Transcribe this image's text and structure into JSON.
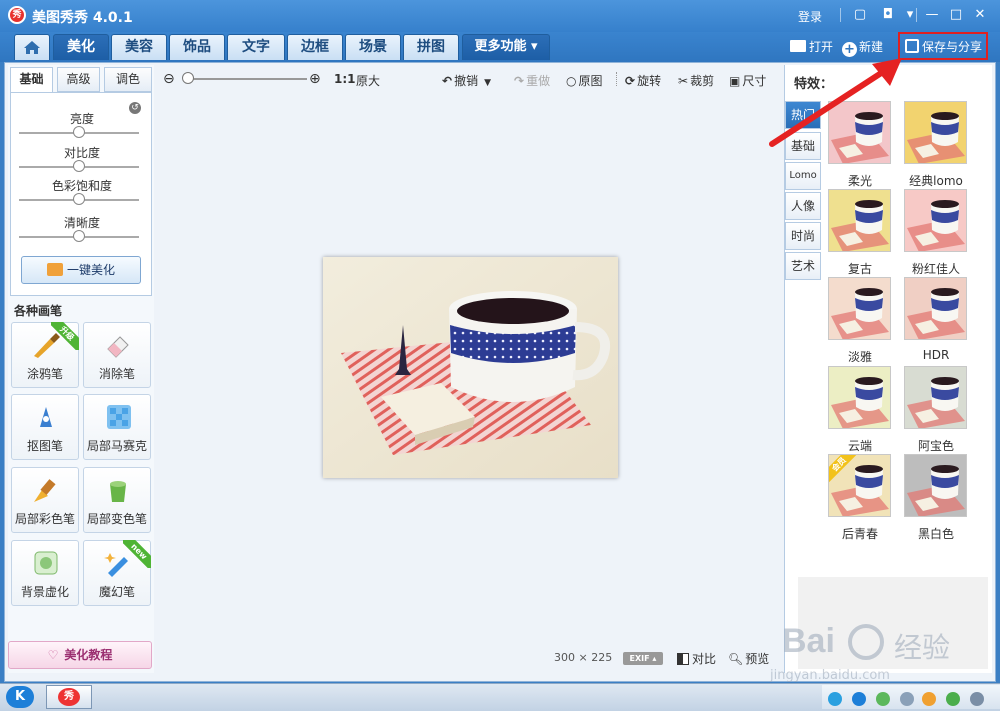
{
  "window": {
    "title": "美图秀秀 4.0.1",
    "logo_text": "秀",
    "login": "登录"
  },
  "main_tabs": [
    "美化",
    "美容",
    "饰品",
    "文字",
    "边框",
    "场景",
    "拼图"
  ],
  "more_tab": "更多功能 ▾",
  "actions": {
    "open": "打开",
    "new": "新建",
    "save_share": "保存与分享"
  },
  "sub_tabs": [
    "基础",
    "高级",
    "调色"
  ],
  "sliders": [
    {
      "label": "亮度",
      "level": 0.5
    },
    {
      "label": "对比度",
      "level": 0.5
    },
    {
      "label": "色彩饱和度",
      "level": 0.5
    },
    {
      "label": "清晰度",
      "level": 0.5
    }
  ],
  "one_key_button": "一键美化",
  "brush_section_title": "各种画笔",
  "brushes": [
    {
      "label": "涂鸦笔",
      "badge": "升级",
      "icon": "brush-icon"
    },
    {
      "label": "消除笔",
      "badge": "",
      "icon": "eraser-icon"
    },
    {
      "label": "抠图笔",
      "badge": "",
      "icon": "cutout-pen-icon"
    },
    {
      "label": "局部马赛克",
      "badge": "",
      "icon": "mosaic-icon"
    },
    {
      "label": "局部彩色笔",
      "badge": "",
      "icon": "color-brush-icon"
    },
    {
      "label": "局部变色笔",
      "badge": "",
      "icon": "paint-bucket-icon"
    },
    {
      "label": "背景虚化",
      "badge": "",
      "icon": "blur-icon"
    },
    {
      "label": "魔幻笔",
      "badge": "new",
      "icon": "magic-pen-icon"
    }
  ],
  "tutorial_button": "美化教程",
  "toolbar": {
    "zoom_ratio": "1:1",
    "original_size": "原大",
    "undo": "撤销",
    "redo": "重做",
    "original": "原图",
    "rotate": "旋转",
    "crop": "裁剪",
    "size": "尺寸"
  },
  "image_info": {
    "width": "300",
    "times": "×",
    "height": "225",
    "exif": "EXIF"
  },
  "bottom_tools": {
    "compare": "对比",
    "preview": "预览"
  },
  "effects": {
    "title": "特效：",
    "categories": [
      "热门",
      "基础",
      "Lomo",
      "人像",
      "时尚",
      "艺术"
    ],
    "items": [
      {
        "label": "柔光",
        "tint": "#f3c6c9"
      },
      {
        "label": "经典lomo",
        "tint": "#f2d36f"
      },
      {
        "label": "复古",
        "tint": "#efe08f"
      },
      {
        "label": "粉红佳人",
        "tint": "#f7c9c6"
      },
      {
        "label": "淡雅",
        "tint": "#f4dccd"
      },
      {
        "label": "HDR",
        "tint": "#f0cfc4"
      },
      {
        "label": "云端",
        "tint": "#eceec4"
      },
      {
        "label": "阿宝色",
        "tint": "#d8dcd2"
      },
      {
        "label": "后青春",
        "tint": "#f1e3b8",
        "badge": "会员"
      },
      {
        "label": "黑白色",
        "tint": "#bdbdbd"
      }
    ]
  },
  "watermark": {
    "brand": "Bai",
    "brand_cn": "经验",
    "url": "jingyan.baidu.com"
  },
  "taskbar": {
    "k_icon": "K",
    "app_icon": "秀"
  },
  "colors": {
    "title_blue": "#3680cc",
    "highlight_red": "#e02020",
    "active_tab": "#1d5ea6"
  }
}
